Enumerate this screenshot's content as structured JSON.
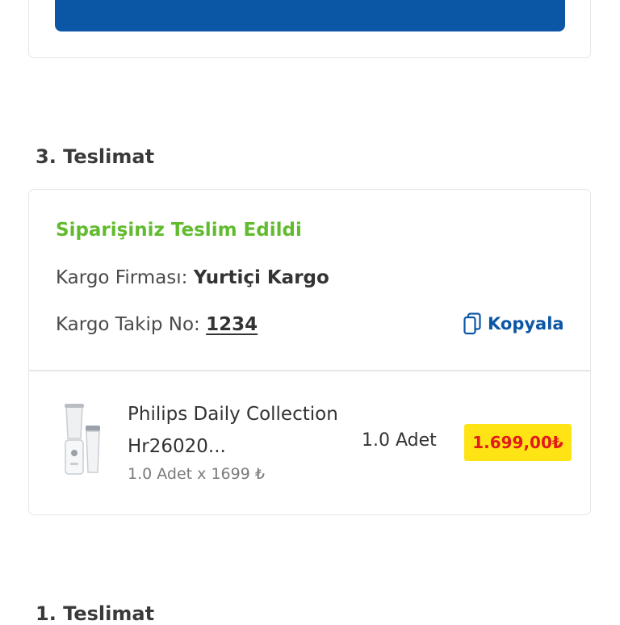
{
  "section3": {
    "title": "3. Teslimat",
    "status": "Siparişiniz Teslim Edildi",
    "carrier_label": "Kargo Firması:",
    "carrier_value": "Yurtiçi Kargo",
    "tracking_label": "Kargo Takip No:",
    "tracking_value": "1234",
    "copy_label": "Kopyala"
  },
  "product": {
    "name": "Philips Daily Collection Hr26020...",
    "quantity": "1.0 Adet",
    "unit_price": "1.0 Adet x 1699 ₺",
    "price": "1.699,00₺"
  },
  "section1": {
    "title": "1. Teslimat"
  },
  "colors": {
    "primary": "#0c56a6",
    "status_green": "#62bb2e",
    "price_bg": "#ffe415",
    "price_text": "#e21a1a"
  },
  "icons": {
    "copy": "copy-icon"
  }
}
